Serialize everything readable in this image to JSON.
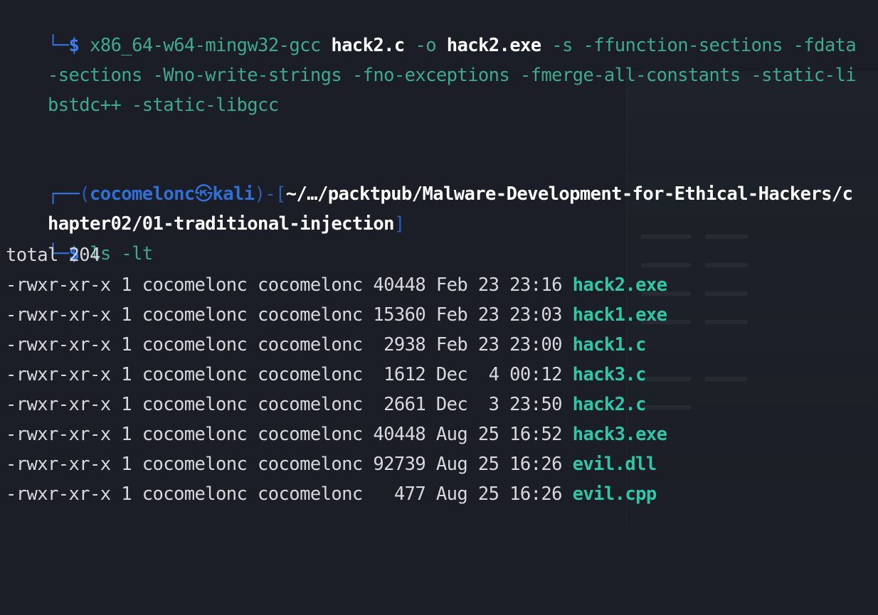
{
  "terminal": {
    "compile": {
      "glyph": "└─",
      "dollar": "$",
      "compiler": "x86_64-w64-mingw32-gcc",
      "source": "hack2.c",
      "opt_o": "-o",
      "output": "hack2.exe",
      "flags_1": "-s -ffunction-sections -fdata",
      "flags_2": "-sections -Wno-write-strings -fno-exceptions -fmerge-all-constants -static-li",
      "flags_3": "bstdc++ -static-libgcc"
    },
    "prompt": {
      "glyph_top": "┌──",
      "open_paren": "(",
      "user": "cocomelonc",
      "at": "㉿",
      "host": "kali",
      "close_paren": ")-[",
      "path_1": "~/…/packtpub/Malware-Development-for-Ethical-Hackers/c",
      "path_2": "hapter02/01-traditional-injection",
      "close_bracket": "]",
      "glyph_bottom": "└─",
      "dollar": "$",
      "command": "ls -lt"
    },
    "total_line": "total 204",
    "listing": [
      {
        "info": "-rwxr-xr-x 1 cocomelonc cocomelonc 40448 Feb 23 23:16 ",
        "name": "hack2.exe"
      },
      {
        "info": "-rwxr-xr-x 1 cocomelonc cocomelonc 15360 Feb 23 23:03 ",
        "name": "hack1.exe"
      },
      {
        "info": "-rwxr-xr-x 1 cocomelonc cocomelonc  2938 Feb 23 23:00 ",
        "name": "hack1.c"
      },
      {
        "info": "-rwxr-xr-x 1 cocomelonc cocomelonc  1612 Dec  4 00:12 ",
        "name": "hack3.c"
      },
      {
        "info": "-rwxr-xr-x 1 cocomelonc cocomelonc  2661 Dec  3 23:50 ",
        "name": "hack2.c"
      },
      {
        "info": "-rwxr-xr-x 1 cocomelonc cocomelonc 40448 Aug 25 16:52 ",
        "name": "hack3.exe"
      },
      {
        "info": "-rwxr-xr-x 1 cocomelonc cocomelonc 92739 Aug 25 16:26 ",
        "name": "evil.dll"
      },
      {
        "info": "-rwxr-xr-x 1 cocomelonc cocomelonc   477 Aug 25 16:26 ",
        "name": "evil.cpp"
      }
    ]
  },
  "colors": {
    "background": "#1b1e26",
    "prompt_blue": "#2f6fd6",
    "command_green": "#3fa98e",
    "file_teal": "#2fc7a8",
    "text": "#d7d9de"
  }
}
